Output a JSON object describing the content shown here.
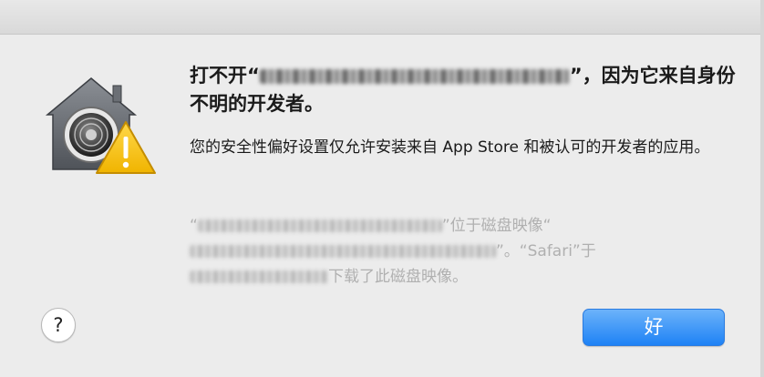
{
  "dialog": {
    "headline_prefix": "打不开“",
    "headline_suffix": "”，因为它来自身份不明的开发者。",
    "info": "您的安全性偏好设置仅允许安装来自 App Store 和被认可的开发者的应用。",
    "detail": {
      "open_quote": "“",
      "mid1": "”位于磁盘映像“",
      "mid2": "”。“Safari”于",
      "end": "下载了此磁盘映像。"
    },
    "help_label": "?",
    "ok_label": "好"
  },
  "icons": {
    "app_icon": "gatekeeper-lock-house-icon",
    "warning_badge": "warning-triangle-icon"
  },
  "colors": {
    "button_blue": "#1e82f5",
    "warning_yellow": "#f5c518",
    "background": "#ececec"
  }
}
